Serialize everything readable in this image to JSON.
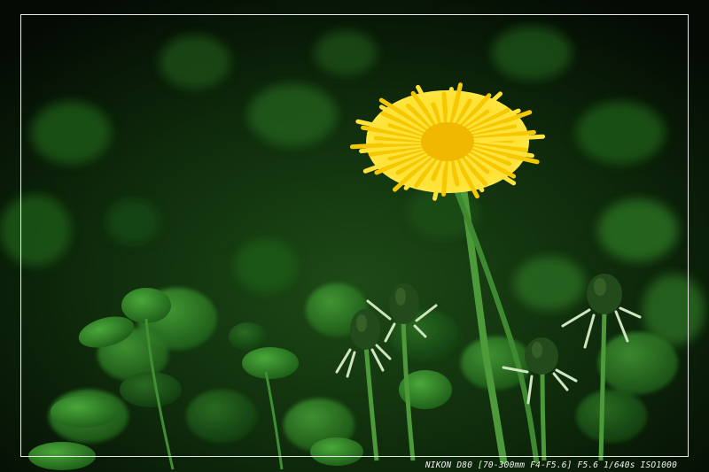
{
  "photo": {
    "exif_caption": "NIKON D80 [70-300mm F4-F5.6] F5.6 1/640s ISO1000"
  }
}
